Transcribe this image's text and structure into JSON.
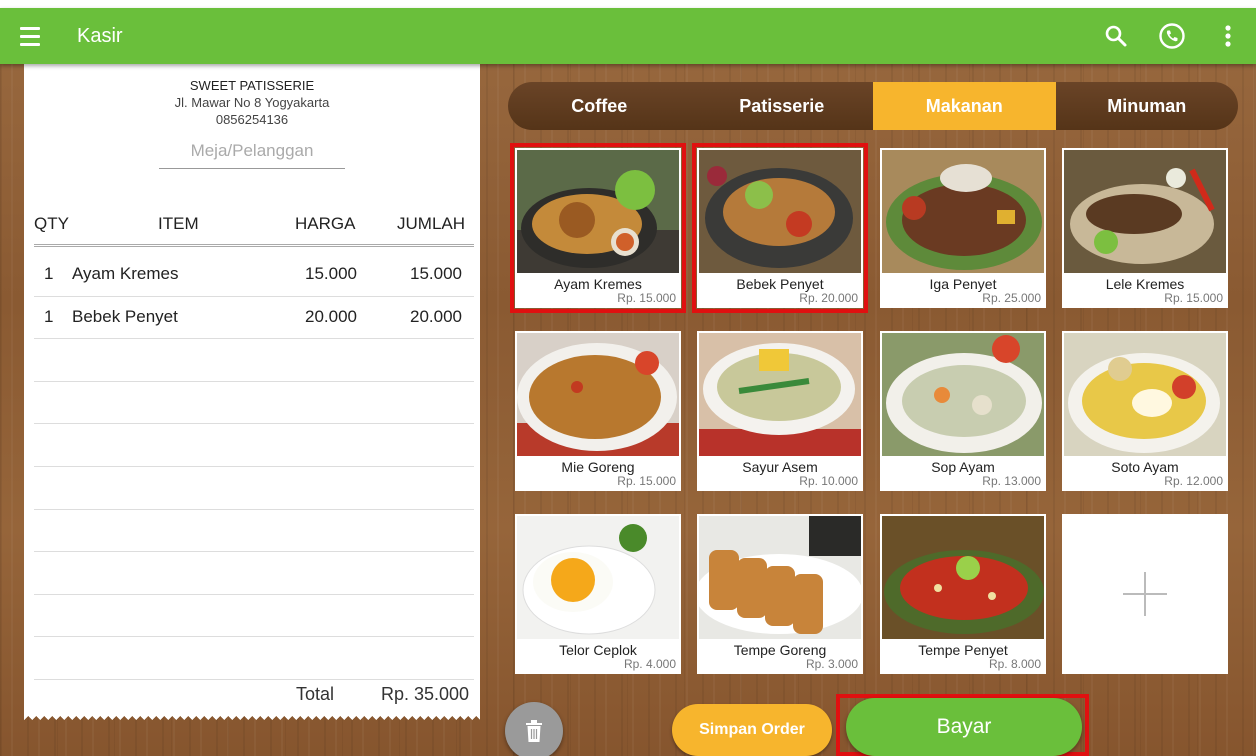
{
  "appbar": {
    "title": "Kasir",
    "color": "#6abf3b",
    "icons": [
      "menu-icon",
      "search-icon",
      "phone-icon",
      "more-vert-icon"
    ]
  },
  "receipt": {
    "store_name": "SWEET PATISSERIE",
    "address": "Jl. Mawar No 8 Yogyakarta",
    "phone": "0856254136",
    "table_placeholder": "Meja/Pelanggan",
    "headers": {
      "qty": "QTY",
      "item": "ITEM",
      "price": "HARGA",
      "amount": "JUMLAH"
    },
    "items": [
      {
        "qty": "1",
        "name": "Ayam Kremes",
        "price": "15.000",
        "amount": "15.000"
      },
      {
        "qty": "1",
        "name": "Bebek Penyet",
        "price": "20.000",
        "amount": "20.000"
      }
    ],
    "total_label": "Total",
    "total_value": "Rp. 35.000"
  },
  "tabs": [
    {
      "label": "Coffee",
      "active": false
    },
    {
      "label": "Patisserie",
      "active": false
    },
    {
      "label": "Makanan",
      "active": true
    },
    {
      "label": "Minuman",
      "active": false
    }
  ],
  "products": [
    {
      "name": "Ayam Kremes",
      "price": "Rp. 15.000",
      "selected": true
    },
    {
      "name": "Bebek Penyet",
      "price": "Rp. 20.000",
      "selected": true
    },
    {
      "name": "Iga Penyet",
      "price": "Rp. 25.000",
      "selected": false
    },
    {
      "name": "Lele Kremes",
      "price": "Rp. 15.000",
      "selected": false
    },
    {
      "name": "Mie Goreng",
      "price": "Rp. 15.000",
      "selected": false
    },
    {
      "name": "Sayur Asem",
      "price": "Rp. 10.000",
      "selected": false
    },
    {
      "name": "Sop Ayam",
      "price": "Rp. 13.000",
      "selected": false
    },
    {
      "name": "Soto Ayam",
      "price": "Rp. 12.000",
      "selected": false
    },
    {
      "name": "Telor Ceplok",
      "price": "Rp. 4.000",
      "selected": false
    },
    {
      "name": "Tempe Goreng",
      "price": "Rp. 3.000",
      "selected": false
    },
    {
      "name": "Tempe Penyet",
      "price": "Rp. 8.000",
      "selected": false
    }
  ],
  "actions": {
    "save_label": "Simpan Order",
    "pay_label": "Bayar"
  },
  "colors": {
    "green": "#6abf3b",
    "accent": "#f7b52d",
    "highlight": "#e01010"
  }
}
